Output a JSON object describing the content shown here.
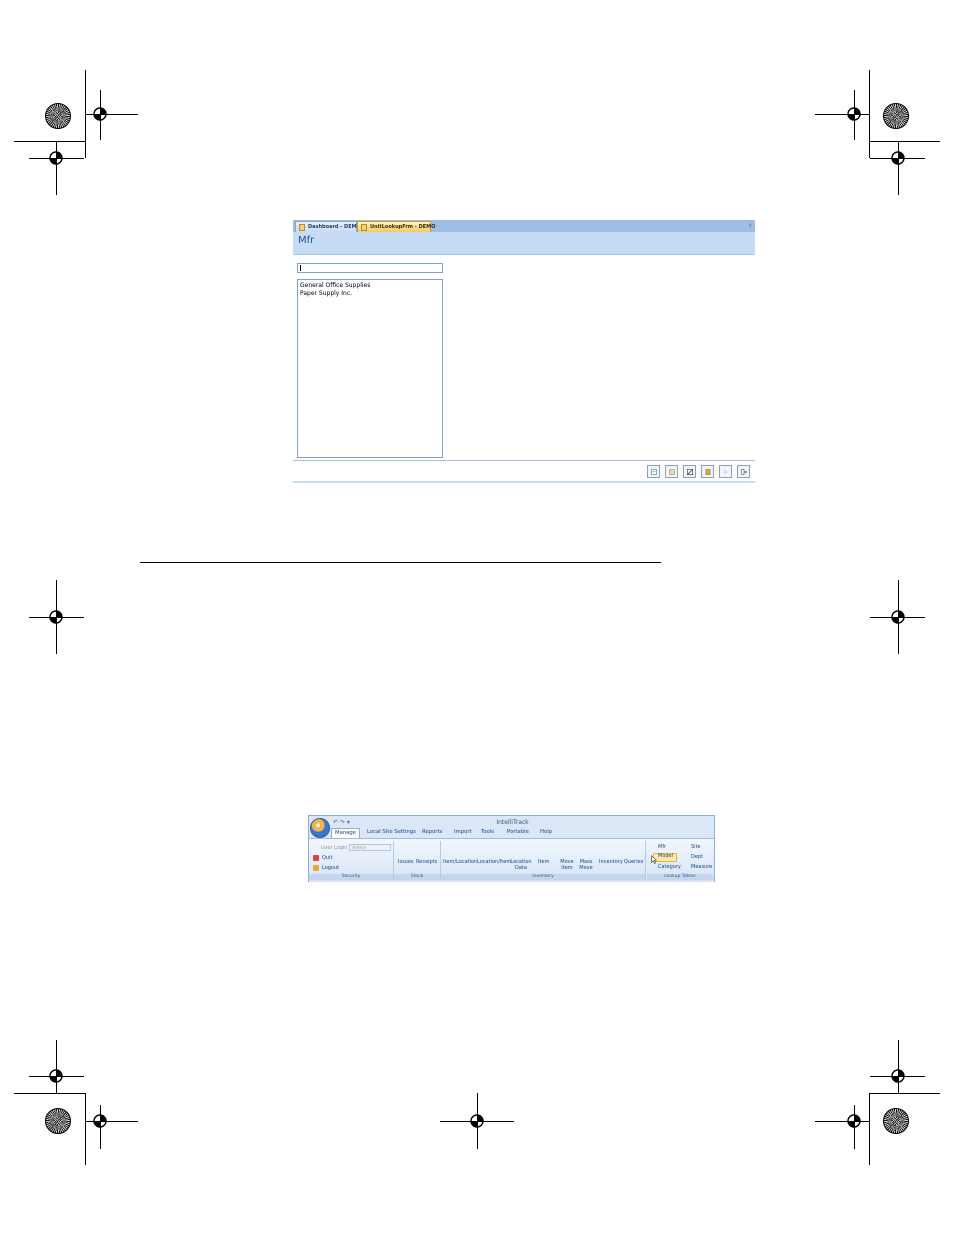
{
  "lookup_form": {
    "tabs": [
      {
        "label": "Dashboard - DEMO",
        "active": false
      },
      {
        "label": "UnitLookupFrm - DEMO",
        "active": true
      }
    ],
    "close_glyph": "x",
    "title": "Mfr",
    "search": {
      "value": "",
      "placeholder": ""
    },
    "list_items": [
      "General Office Supplies",
      "Paper Supply Inc."
    ],
    "toolbar_icons": [
      "new-record-icon",
      "save-icon",
      "edit-icon",
      "delete-icon",
      "undo-icon",
      "exit-icon"
    ]
  },
  "ribbon": {
    "app_title": "IntelliTrack",
    "tabs": [
      "Manage",
      "Local Site Settings",
      "Reports",
      "Import",
      "Tools",
      "Portable",
      "Help"
    ],
    "active_tab": "Manage",
    "security": {
      "user_login_label": "User Login",
      "user_login_value": "Admin",
      "quit_label": "Quit",
      "logout_label": "Logout",
      "group_label": "Security"
    },
    "stock": {
      "buttons": [
        "Issues",
        "Receipts"
      ],
      "group_label": "Stock"
    },
    "inventory": {
      "buttons": [
        "Item/Location",
        "Location/Item",
        "Location Data",
        "Item",
        "Move Item",
        "Mass Move",
        "Inventory",
        "Queries"
      ],
      "group_label": "Inventory"
    },
    "lookup_tables": {
      "buttons": [
        "Mfr",
        "Site",
        "Model",
        "Dept",
        "Category",
        "Measure"
      ],
      "highlighted": "Model",
      "group_label": "Lookup Tables"
    }
  },
  "colors": {
    "tab_strip": "#9ebee6",
    "form_header": "#c6dcf5",
    "title_text": "#1f4f93",
    "active_tab": "#f7c95c",
    "ribbon_bg": "#dbe7f6"
  }
}
